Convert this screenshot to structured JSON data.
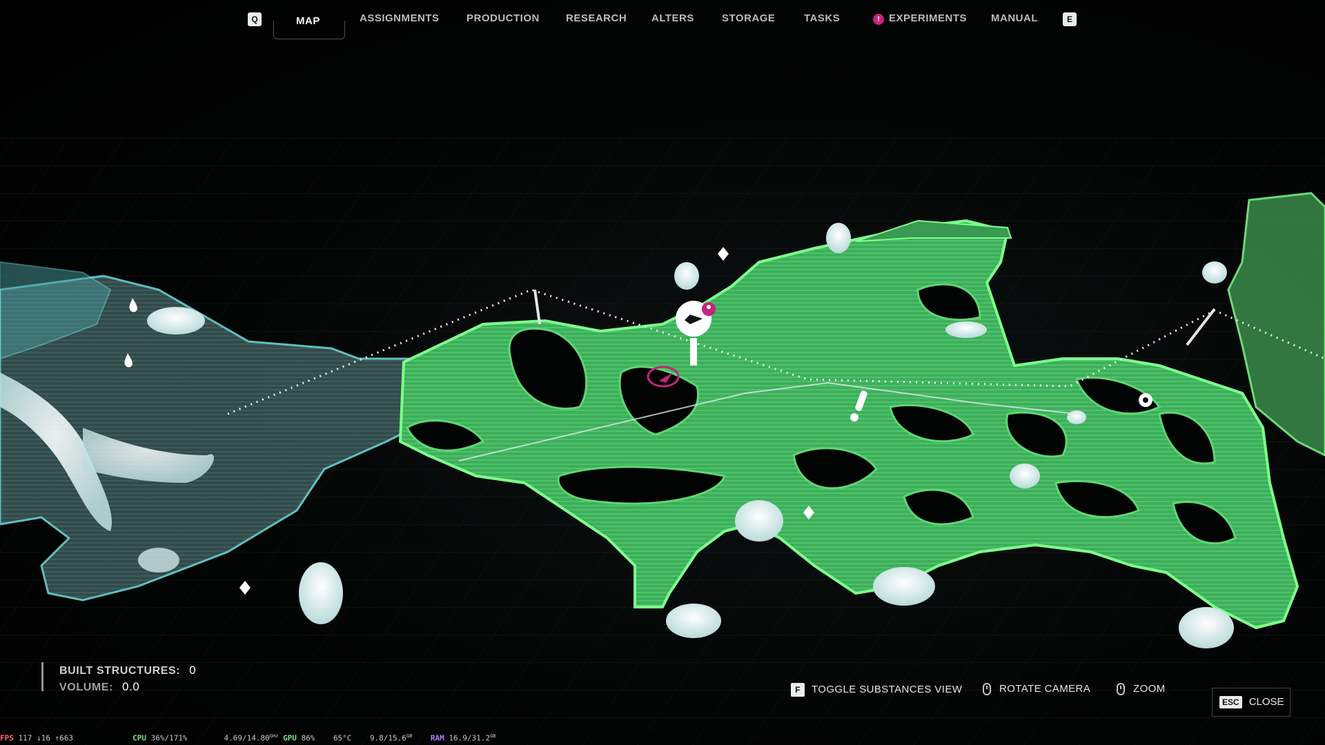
{
  "nav": {
    "left_key": "Q",
    "right_key": "E",
    "tabs": [
      {
        "label": "MAP",
        "active": true
      },
      {
        "label": "ASSIGNMENTS"
      },
      {
        "label": "PRODUCTION"
      },
      {
        "label": "RESEARCH"
      },
      {
        "label": "ALTERS"
      },
      {
        "label": "STORAGE"
      },
      {
        "label": "TASKS"
      },
      {
        "label": "EXPERIMENTS",
        "has_alert": true
      },
      {
        "label": "MANUAL"
      }
    ],
    "experiments_alert_icon": "!"
  },
  "stats": {
    "built_structures_label": "BUILT STRUCTURES:",
    "built_structures_value": "0",
    "volume_label": "VOLUME:",
    "volume_value": "0.0"
  },
  "controls": {
    "toggle_key": "F",
    "toggle_label": "TOGGLE SUBSTANCES VIEW",
    "rotate_label": "ROTATE CAMERA",
    "zoom_label": "ZOOM",
    "close_key": "ESC",
    "close_label": "CLOSE"
  },
  "perf": {
    "fps_tag": "FPS",
    "fps": "117 ↓16 ↑663",
    "cpu_tag": "CPU",
    "cpu": "36%/171%",
    "clock": "4.69/14.80",
    "clock_unit": "GHz",
    "gpu_tag": "GPU",
    "gpu": "86%",
    "temp": "65°C",
    "vram": "9.8/15.6",
    "vram_unit": "GB",
    "ram_tag": "RAM",
    "ram": "16.9/31.2",
    "ram_unit": "GB"
  },
  "colors": {
    "explored_green": "#3fae5c",
    "green_edge": "#7dff8a",
    "unexplored_teal": "#2f4a4a",
    "teal_edge": "#6fe0e0",
    "accent_magenta": "#c4247c"
  },
  "map_icons": [
    "location-pin-icon",
    "water-drop-icon",
    "resource-diamond-icon",
    "gear-icon",
    "exclamation-marker-icon",
    "player-marker-icon"
  ]
}
